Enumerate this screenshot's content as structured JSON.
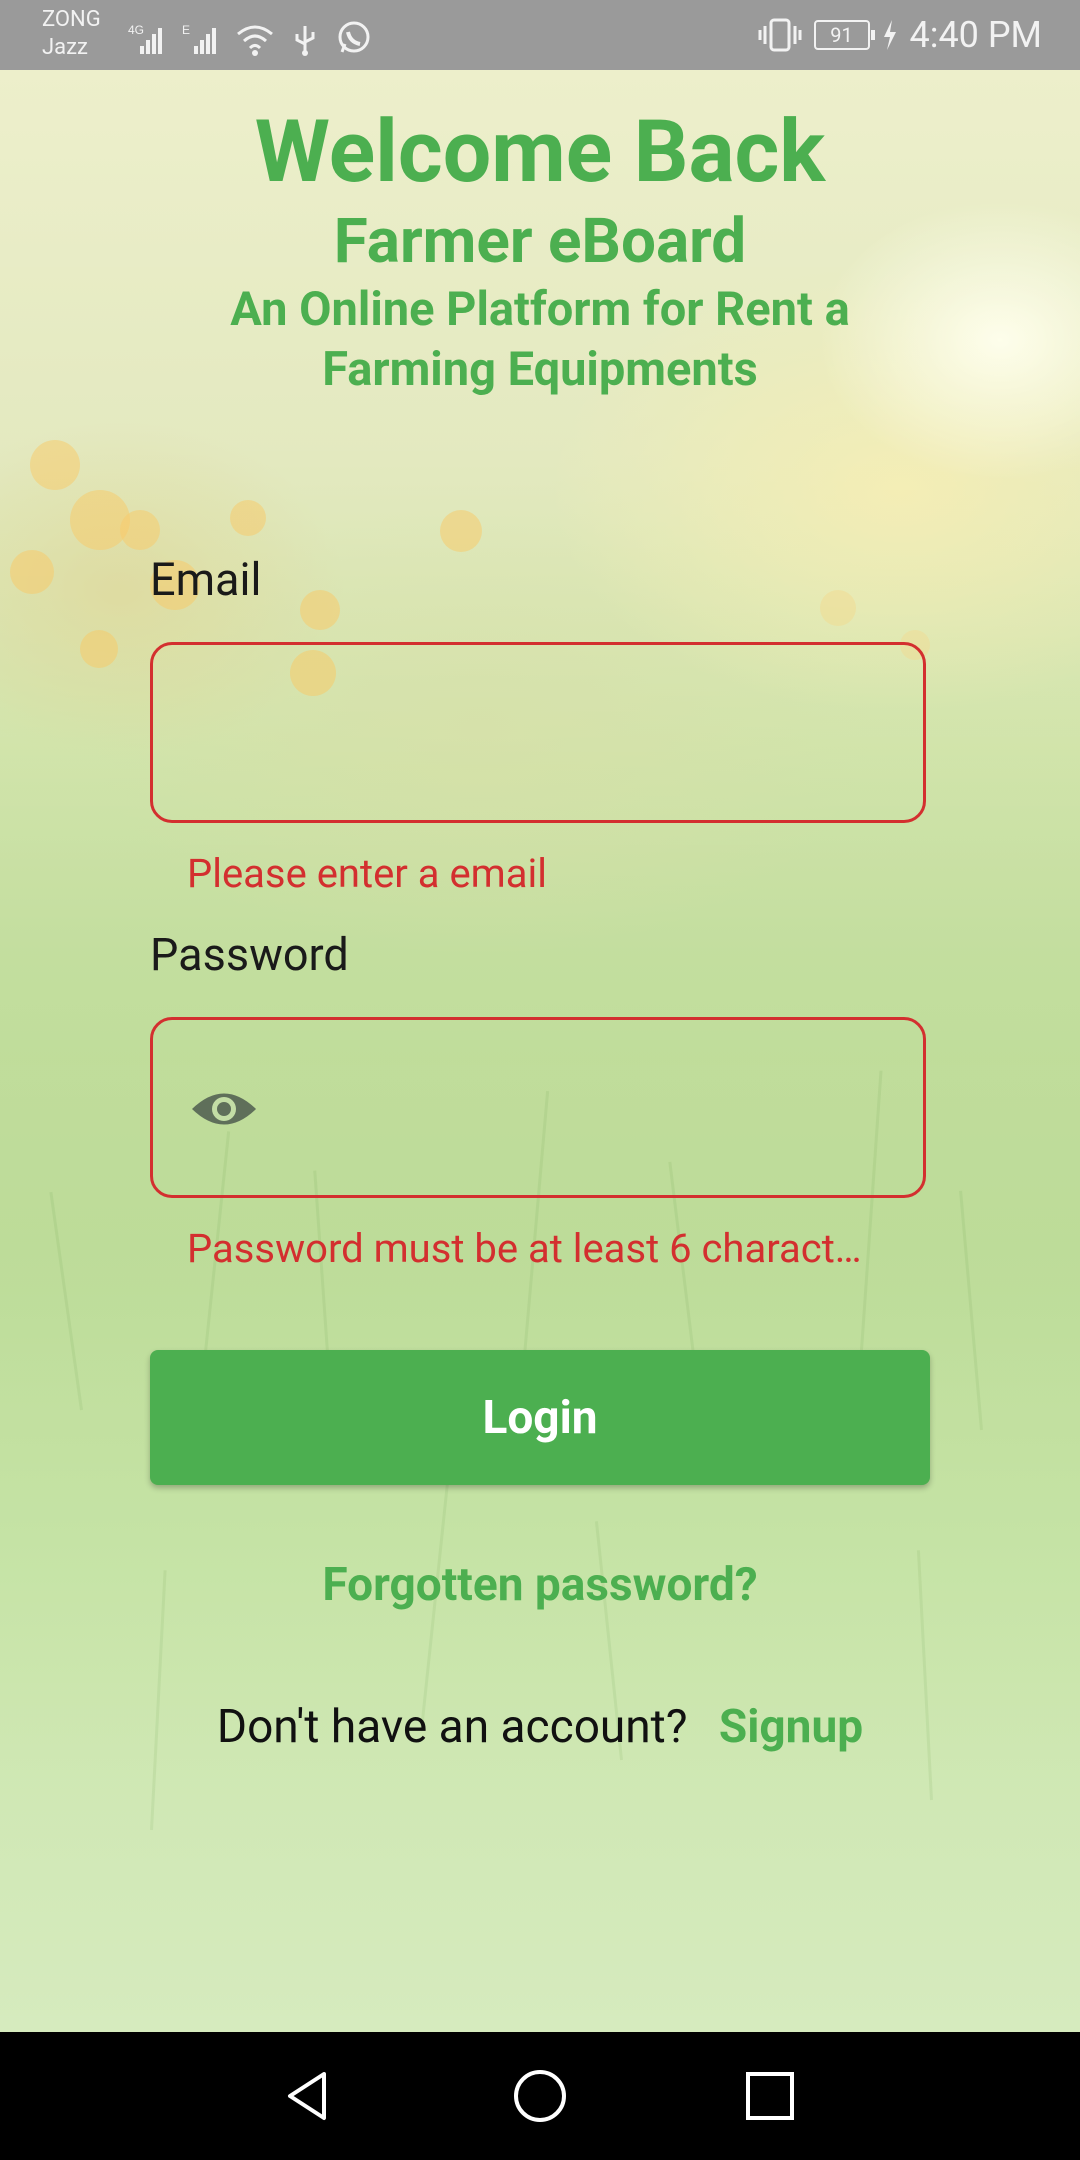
{
  "status_bar": {
    "carrier_1": "ZONG",
    "carrier_2": "Jazz",
    "network_1": "4G",
    "network_2": "E",
    "battery": "91",
    "time": "4:40 PM",
    "icons": [
      "signal-icon",
      "signal-icon",
      "wifi-icon",
      "usb-icon",
      "whatsapp-icon",
      "vibrate-icon",
      "battery-icon",
      "charging-icon"
    ]
  },
  "header": {
    "title": "Welcome Back",
    "subtitle": "Farmer eBoard",
    "tagline": "An Online Platform for Rent a Farming Equipments"
  },
  "form": {
    "email": {
      "label": "Email",
      "value": "",
      "error": "Please enter a email"
    },
    "password": {
      "label": "Password",
      "value": "",
      "error": "Password must be at least 6 charact…",
      "toggle_icon": "eye-icon"
    },
    "login_label": "Login",
    "forgot_label": "Forgotten password?",
    "signup_prompt": "Don't have an account?",
    "signup_label": "Signup"
  },
  "colors": {
    "accent": "#4caf50",
    "error": "#d32f2f",
    "status_bar": "#9a9a9a",
    "nav_bar": "#000000"
  },
  "nav_bar": {
    "icons": [
      "back-icon",
      "home-icon",
      "recents-icon"
    ]
  }
}
